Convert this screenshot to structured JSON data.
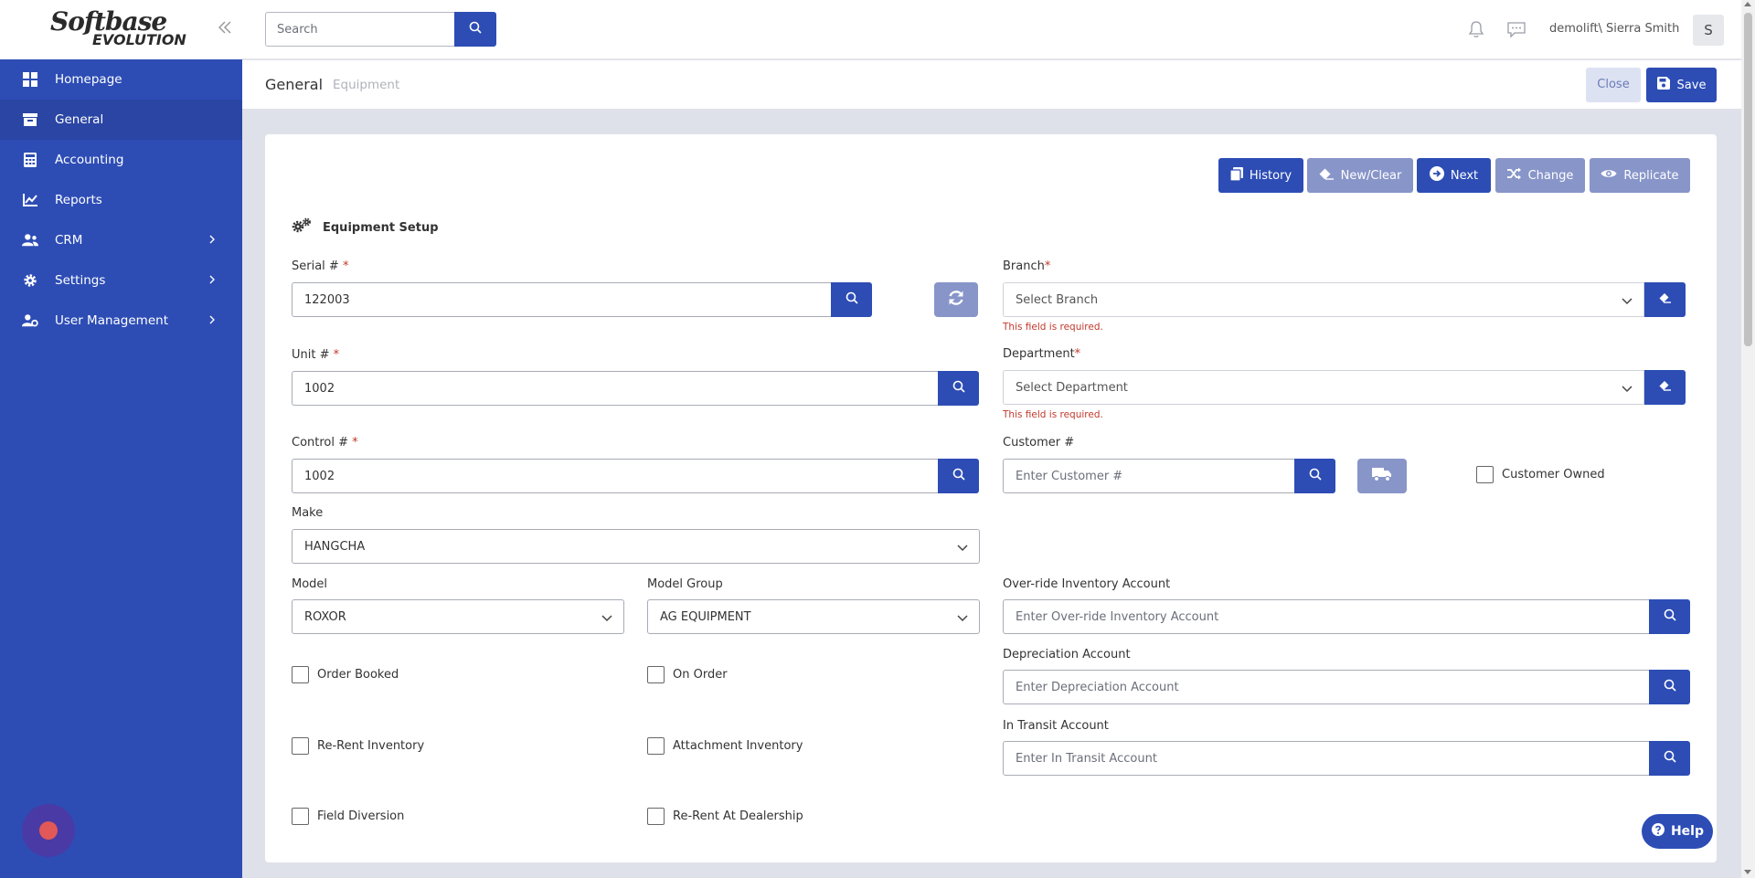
{
  "brand": {
    "line1": "Softbase",
    "line2": "EVOLUTION"
  },
  "sidebar": {
    "items": [
      {
        "label": "Homepage",
        "icon": "dashboard-icon"
      },
      {
        "label": "General",
        "icon": "archive-icon"
      },
      {
        "label": "Accounting",
        "icon": "calculator-icon"
      },
      {
        "label": "Reports",
        "icon": "chart-icon"
      },
      {
        "label": "CRM",
        "icon": "users-icon"
      },
      {
        "label": "Settings",
        "icon": "gear-icon"
      },
      {
        "label": "User Management",
        "icon": "user-gear-icon"
      }
    ]
  },
  "topbar": {
    "search_placeholder": "Search",
    "user": "demolift\\ Sierra Smith",
    "avatar_initial": "S"
  },
  "header": {
    "title": "General",
    "subtitle": "Equipment",
    "close_label": "Close",
    "save_label": "Save"
  },
  "toolbar": {
    "history": "History",
    "new_clear": "New/Clear",
    "next": "Next",
    "change": "Change",
    "replicate": "Replicate"
  },
  "section": {
    "title": "Equipment Setup"
  },
  "form": {
    "serial": {
      "label": "Serial # ",
      "required": "*",
      "value": "122003"
    },
    "unit": {
      "label": "Unit # ",
      "required": "*",
      "value": "1002"
    },
    "control": {
      "label": "Control # ",
      "required": "*",
      "value": "1002"
    },
    "make": {
      "label": "Make",
      "value": "HANGCHA"
    },
    "model": {
      "label": "Model",
      "value": "ROXOR"
    },
    "model_group": {
      "label": "Model Group",
      "value": "AG EQUIPMENT"
    },
    "branch": {
      "label": "Branch",
      "required": "*",
      "placeholder": "Select Branch",
      "error": "This field is required."
    },
    "department": {
      "label": "Department",
      "required": "*",
      "placeholder": "Select Department",
      "error": "This field is required."
    },
    "customer": {
      "label": "Customer #",
      "placeholder": "Enter Customer #"
    },
    "customer_owned": "Customer Owned",
    "override_inventory": {
      "label": "Over-ride Inventory Account",
      "placeholder": "Enter Over-ride Inventory Account"
    },
    "depreciation": {
      "label": "Depreciation Account",
      "placeholder": "Enter Depreciation Account"
    },
    "in_transit": {
      "label": "In Transit Account",
      "placeholder": "Enter In Transit Account"
    },
    "checkboxes": {
      "order_booked": "Order Booked",
      "on_order": "On Order",
      "rerent_inventory": "Re-Rent Inventory",
      "attachment_inventory": "Attachment Inventory",
      "field_diversion": "Field Diversion",
      "rerent_dealership": "Re-Rent At Dealership"
    }
  },
  "help_label": "Help",
  "colors": {
    "primary": "#2d4db5",
    "primary_light": "#8895c9",
    "error": "#c0392b"
  }
}
